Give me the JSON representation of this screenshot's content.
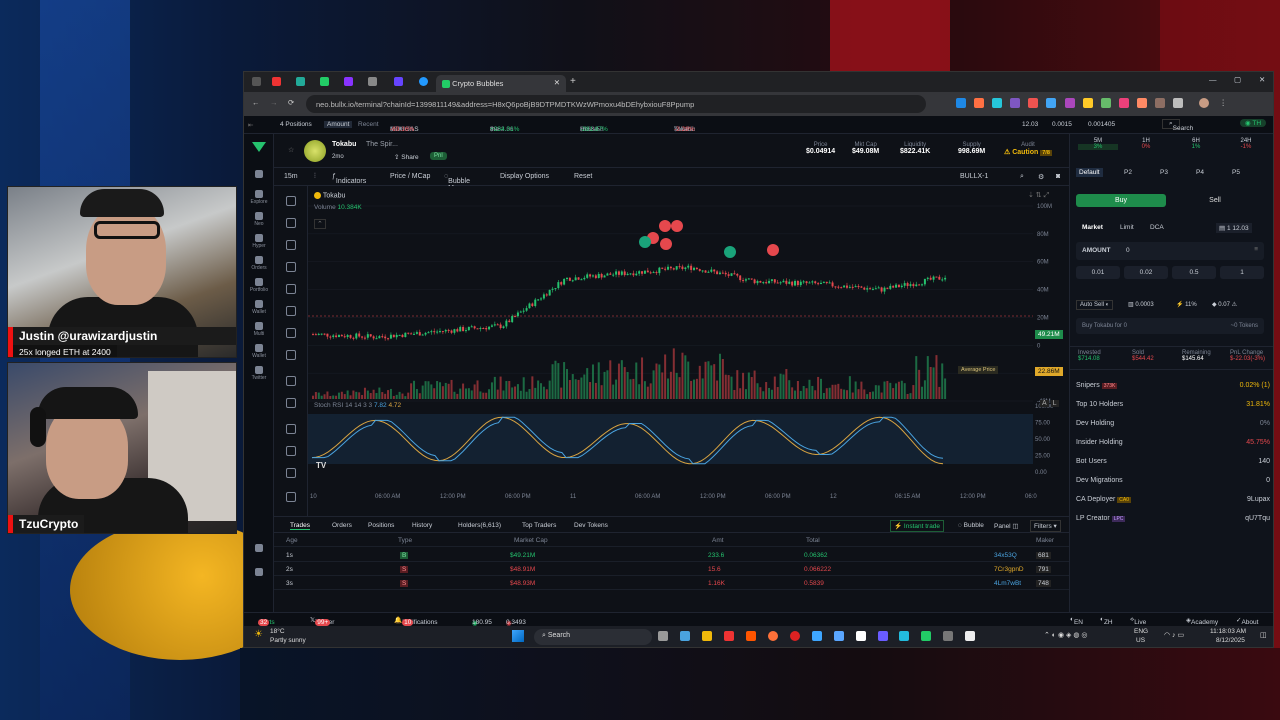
{
  "streamers": [
    {
      "name": "Justin @urawizardjustin",
      "caption": "25x longed ETH at 2400"
    },
    {
      "name": "TzuCrypto",
      "caption": ""
    }
  ],
  "browser": {
    "tab_title": "Crypto Bubbles",
    "url": "neo.bullx.io/terminal?chainId=1399811149&address=H8xQ6poBjB9DTPMDTKWzWPmoxu4bDEhybxiouF8Ppump"
  },
  "ticker": {
    "positions": "4 Positions",
    "amount": "Amount",
    "recent": "Recent",
    "items": [
      {
        "name": "MDUOAS",
        "price": "$398.59",
        "change": "-69.16%"
      },
      {
        "name": "the",
        "price": "$262.36",
        "change": "+234.01%"
      },
      {
        "name": "House",
        "price": "$160.58",
        "change": "-281.87%"
      },
      {
        "name": "Tokabu",
        "price": "$164.2",
        "change": "-3.28%"
      }
    ],
    "right_vals": [
      "12.03",
      "0.0015",
      "0.001405"
    ],
    "search": "Search"
  },
  "nav": [
    "Explore",
    "Neo",
    "Hyper",
    "Orders",
    "Portfolio",
    "Wallet",
    "Multi",
    "Wallet",
    "Twitter"
  ],
  "token": {
    "name": "Tokabu",
    "desc": "The Spir...",
    "age": "2mo",
    "share": "Share",
    "badge": "Pnl",
    "stats": [
      {
        "label": "Price",
        "value": "$0.04914"
      },
      {
        "label": "Mkt Cap",
        "value": "$49.08M"
      },
      {
        "label": "Liquidity",
        "value": "$822.41K"
      },
      {
        "label": "Supply",
        "value": "998.69M"
      },
      {
        "label": "Audit",
        "value": "Caution"
      }
    ],
    "audit_count": "7/8"
  },
  "toolbar": {
    "interval": "15m",
    "indicators": "Indicators",
    "price_mcap": "Price / MCap",
    "bubble_map": "Bubble Map",
    "display": "Display Options",
    "reset": "Reset",
    "pair": "BULLX-1"
  },
  "chart": {
    "series_name": "Tokabu",
    "volume_label": "Volume",
    "volume_value": "10.384K",
    "y_ticks": [
      "100M",
      "80M",
      "60M",
      "40M",
      "20M",
      "0",
      "-20M",
      "-40M"
    ],
    "current_tag": "49.21M",
    "avg_tag": "22.86M",
    "avg_label": "Average Price",
    "rsi_label": "Stoch RSI 14 14 3 3",
    "rsi_val1": "7.82",
    "rsi_val2": "4.72",
    "rsi_ticks": [
      "100.00",
      "75.00",
      "50.00",
      "25.00",
      "0.00"
    ],
    "x_ticks": [
      "10",
      "06:00 AM",
      "12:00 PM",
      "06:00 PM",
      "11",
      "06:00 AM",
      "12:00 PM",
      "06:00 PM",
      "12",
      "06:15 AM",
      "12:00 PM",
      "06:0"
    ],
    "log_a": "A",
    "log_l": "L",
    "tv": "TV"
  },
  "chart_data": {
    "type": "line",
    "title": "",
    "xlabel": "",
    "ylabel": "",
    "x": [
      "10 00:00",
      "10 06:00",
      "10 12:00",
      "10 18:00",
      "11 00:00",
      "11 06:00",
      "11 12:00",
      "11 18:00",
      "12 00:00",
      "12 06:15",
      "12 12:00"
    ],
    "series": [
      {
        "name": "Tokabu",
        "values": [
          8,
          6,
          10,
          14,
          48,
          52,
          56,
          46,
          44,
          40,
          49
        ]
      }
    ],
    "volume": [
      2,
      3,
      5,
      6,
      10,
      12,
      14,
      8,
      6,
      5,
      12
    ],
    "rsi": [
      20,
      80,
      15,
      85,
      20,
      75,
      10,
      80,
      25,
      85,
      10
    ],
    "ylim": [
      -40,
      100
    ]
  },
  "bottom": {
    "tabs": [
      "Trades",
      "Orders",
      "Positions",
      "History",
      "Holders(6,613)",
      "Top Traders",
      "Dev Tokens"
    ],
    "actions": [
      "Instant trade",
      "Bubble",
      "Panel",
      "Filters"
    ],
    "cols": [
      "Age",
      "Type",
      "Market Cap",
      "Amt",
      "Total",
      "Maker"
    ],
    "rows": [
      {
        "age": "1s",
        "type": "B",
        "mcap": "$49.21M",
        "amt": "233.6",
        "total": "0.06362",
        "maker": "34x53Q",
        "count": "681"
      },
      {
        "age": "2s",
        "type": "S",
        "mcap": "$48.91M",
        "amt": "15.6",
        "total": "0.066222",
        "maker": "7Cr3gpnD",
        "count": "791"
      },
      {
        "age": "3s",
        "type": "S",
        "mcap": "$48.93M",
        "amt": "1.16K",
        "total": "0.5839",
        "maker": "4Lm7wBt",
        "count": "748"
      }
    ]
  },
  "trade": {
    "periods": [
      {
        "label": "5M",
        "val": "3%"
      },
      {
        "label": "1H",
        "val": "0%"
      },
      {
        "label": "6H",
        "val": "1%"
      },
      {
        "label": "24H",
        "val": "-1%"
      }
    ],
    "presets": [
      "Default",
      "P2",
      "P3",
      "P4",
      "P5"
    ],
    "buy": "Buy",
    "sell": "Sell",
    "order_tabs": [
      "Market",
      "Limit",
      "DCA"
    ],
    "wallet": "12.03",
    "amount_label": "AMOUNT",
    "amount_val": "0",
    "quick": [
      "0.01",
      "0.02",
      "0.5",
      "1"
    ],
    "auto_sell": "Auto Sell",
    "auto_vals": [
      "0.0003",
      "11%",
      "0.07"
    ],
    "buy_input_placeholder": "Buy Tokabu for 0",
    "buy_input_right": "~0 Tokens",
    "stats_labels": [
      "Invested",
      "Sold",
      "Remaining",
      "PnL Change"
    ],
    "stats_vals": [
      "$714.08",
      "$544.42",
      "$145.64",
      "$-22.03(-3%)"
    ],
    "metrics": [
      {
        "label": "Snipers",
        "tag": "373K",
        "val": "0.02% (1)"
      },
      {
        "label": "Top 10 Holders",
        "tag": "",
        "val": "31.81%"
      },
      {
        "label": "Dev Holding",
        "tag": "",
        "val": "0%"
      },
      {
        "label": "Insider Holding",
        "tag": "",
        "val": "45.75%"
      },
      {
        "label": "Bot Users",
        "tag": "",
        "val": "140"
      },
      {
        "label": "Dev Migrations",
        "tag": "",
        "val": "0"
      },
      {
        "label": "CA Deployer",
        "tag": "CA0",
        "val": "9Lupax"
      },
      {
        "label": "LP Creator",
        "tag": "LPC",
        "val": "qU7Tqu"
      }
    ]
  },
  "footer": {
    "alerts": "Alerts",
    "alerts_n": "32",
    "twitter": "Twitter Tracker",
    "twitter_n": "99+",
    "notifications": "Notifications",
    "notif_n": "10",
    "v1": "180.95",
    "v2": "0.3493",
    "lang": "EN",
    "zh": "ZH",
    "live": "Live Bribe",
    "academy": "Academy",
    "about": "About"
  },
  "taskbar": {
    "temp": "18°C",
    "weather": "Partly sunny",
    "search": "Search",
    "lang1": "ENG",
    "lang2": "US",
    "time": "11:18:03 AM",
    "date": "8/12/2025"
  }
}
